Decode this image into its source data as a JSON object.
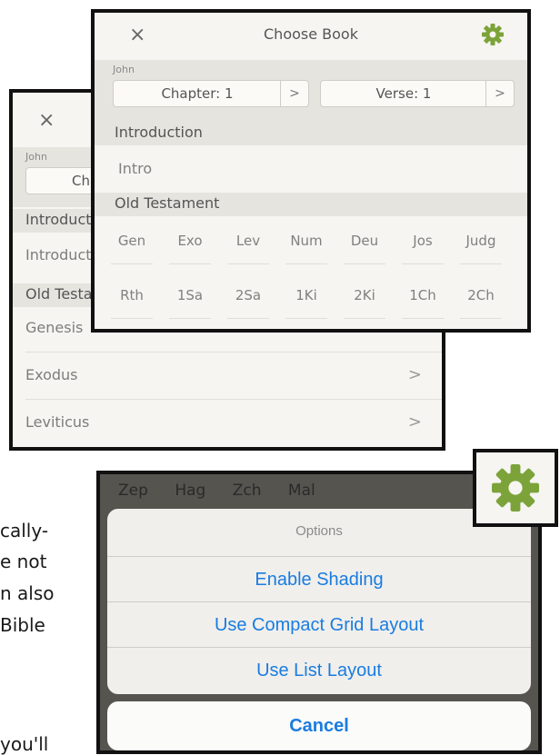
{
  "doc_text": [
    "cally-",
    "e  not",
    "n also",
    "Bible",
    "you'll"
  ],
  "back_panel": {
    "close": "×",
    "book": "John",
    "chapter_partial": "Cha",
    "intro_section": "Introduct",
    "intro_row": "Introducti",
    "ot_section": "Old Testa",
    "rows": [
      {
        "label": "Genesis"
      },
      {
        "label": "Exodus"
      },
      {
        "label": "Leviticus"
      }
    ],
    "chevron": ">"
  },
  "front_panel": {
    "close": "×",
    "title": "Choose Book",
    "book": "John",
    "chapter": "Chapter: 1",
    "verse": "Verse: 1",
    "arrow": ">",
    "intro_section": "Introduction",
    "intro_item": "Intro",
    "ot_section": "Old Testament",
    "grid_row1": [
      "Gen",
      "Exo",
      "Lev",
      "Num",
      "Deu",
      "Jos",
      "Judg"
    ],
    "grid_row2": [
      "Rth",
      "1Sa",
      "2Sa",
      "1Ki",
      "2Ki",
      "1Ch",
      "2Ch"
    ]
  },
  "options_panel": {
    "bg_items": [
      "Zep",
      "Hag",
      "Zch",
      "Mal"
    ],
    "title": "Options",
    "actions": [
      "Enable Shading",
      "Use Compact Grid Layout",
      "Use List Layout"
    ],
    "cancel": "Cancel"
  },
  "colors": {
    "accent": "#7ba33a",
    "link": "#1a7ce0"
  }
}
